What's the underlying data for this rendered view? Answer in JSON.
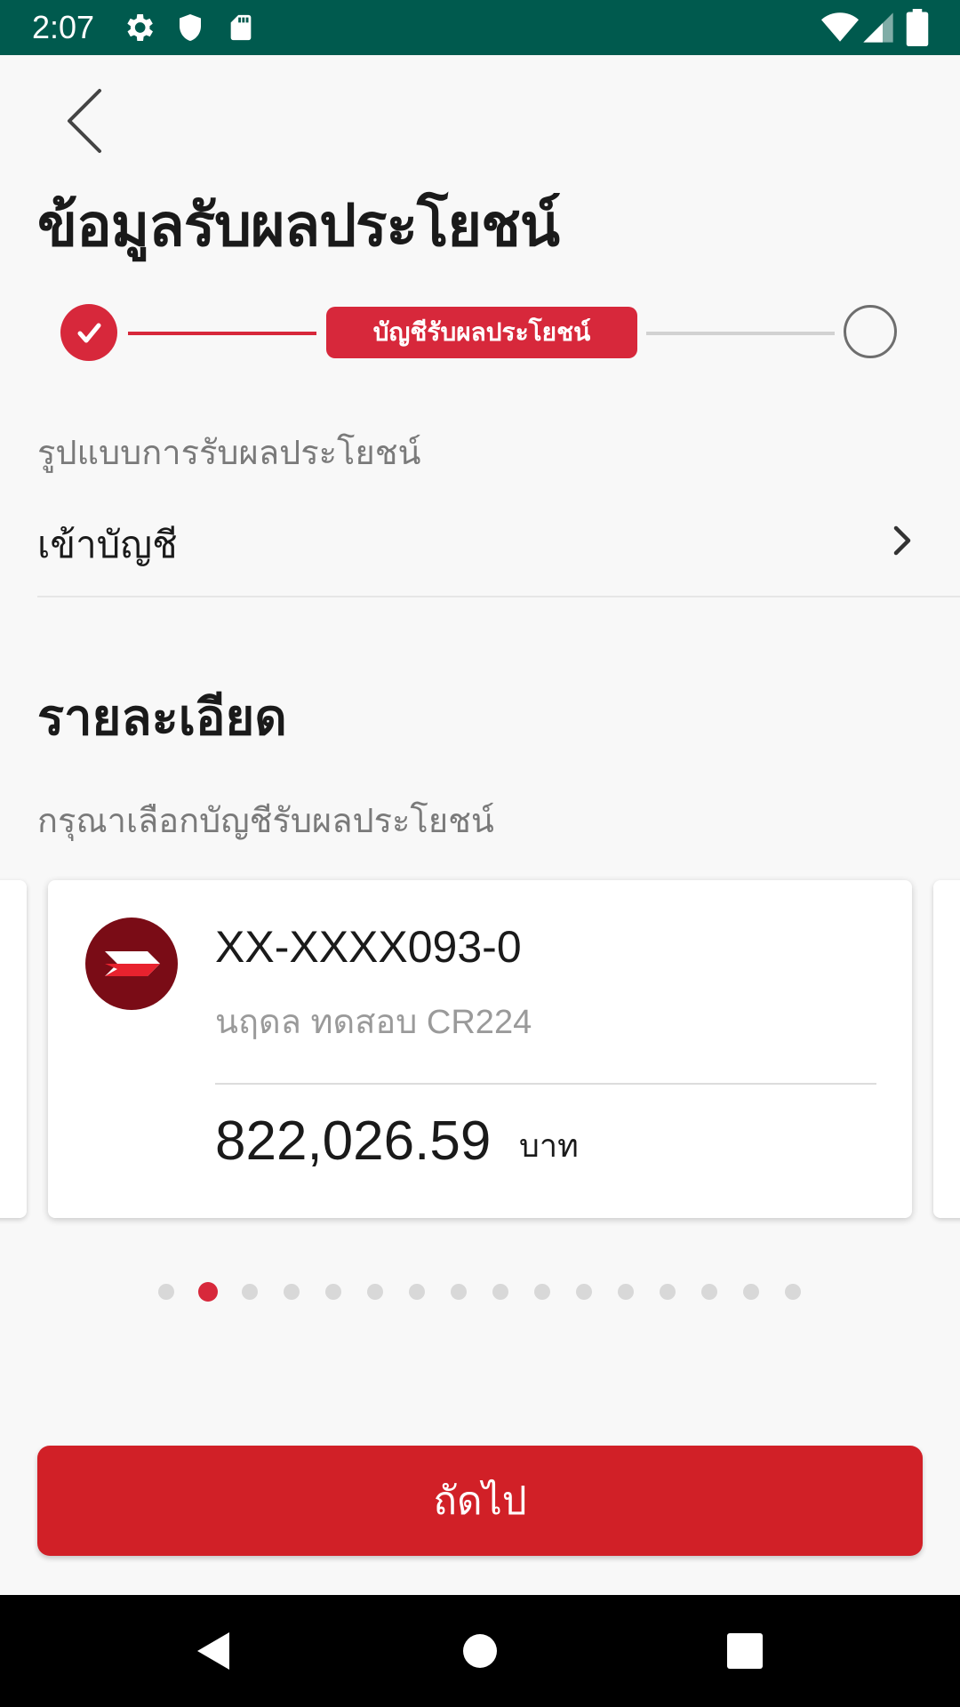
{
  "status_bar": {
    "time": "2:07",
    "background": "#005a4e",
    "icons": [
      "gear-icon",
      "shield-icon",
      "sd-card-icon",
      "wifi-icon",
      "cell-signal-icon",
      "battery-icon"
    ]
  },
  "header": {
    "title": "ข้อมูลรับผลประโยชน์",
    "back_icon": "chevron-left-icon"
  },
  "stepper": {
    "steps": [
      {
        "state": "done",
        "icon": "check-icon"
      },
      {
        "state": "current",
        "label": "บัญชีรับผลประโยชน์"
      },
      {
        "state": "todo"
      }
    ],
    "accent": "#d7283b"
  },
  "benefit_type": {
    "label": "รูปแบบการรับผลประโยชน์",
    "value": "เข้าบัญชี",
    "chevron_icon": "chevron-right-icon"
  },
  "details": {
    "title": "รายละเอียด",
    "hint": "กรุณาเลือกบัญชีรับผลประโยชน์"
  },
  "account_card": {
    "logo_icon": "bank-logo-icon",
    "account_number": "XX-XXXX093-0",
    "account_name": "นฤดล ทดสอบ CR224",
    "balance": "822,026.59",
    "currency": "บาท"
  },
  "pager": {
    "total": 16,
    "active_index": 1
  },
  "actions": {
    "next_label": "ถัดไป",
    "color": "#d12027"
  },
  "nav_bar": {
    "icons": [
      "back-triangle-icon",
      "home-circle-icon",
      "recents-square-icon"
    ]
  }
}
